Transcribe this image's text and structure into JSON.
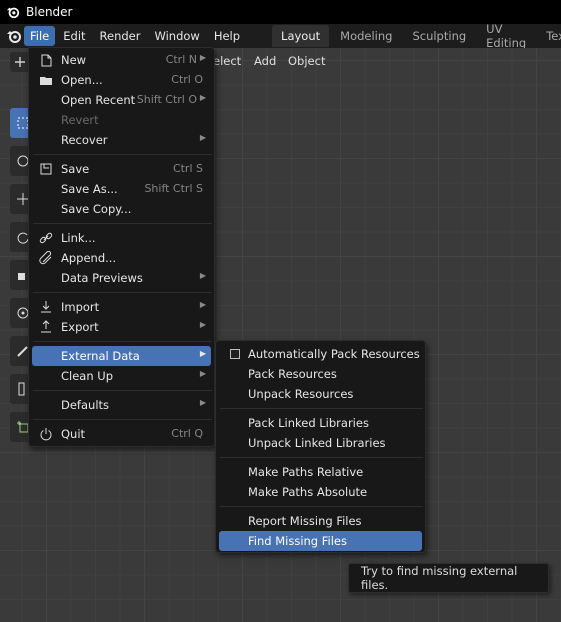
{
  "app": {
    "title": "Blender"
  },
  "topmenu": [
    "File",
    "Edit",
    "Render",
    "Window",
    "Help"
  ],
  "workspace_tabs": [
    "Layout",
    "Modeling",
    "Sculpting",
    "UV Editing",
    "Texture"
  ],
  "viewport_header": {
    "items": [
      "elect",
      "Add",
      "Object"
    ]
  },
  "file_menu": {
    "items": [
      {
        "label": "New",
        "shortcut": "Ctrl N",
        "submenu": true,
        "icon": "new-file-icon"
      },
      {
        "label": "Open...",
        "shortcut": "Ctrl O",
        "icon": "folder-icon"
      },
      {
        "label": "Open Recent",
        "shortcut": "Shift Ctrl O",
        "submenu": true
      },
      {
        "label": "Revert",
        "disabled": true
      },
      {
        "label": "Recover",
        "submenu": true
      },
      {
        "label": "Save",
        "shortcut": "Ctrl S",
        "icon": "save-icon"
      },
      {
        "label": "Save As...",
        "shortcut": "Shift Ctrl S"
      },
      {
        "label": "Save Copy..."
      },
      {
        "label": "Link...",
        "icon": "link-icon"
      },
      {
        "label": "Append...",
        "icon": "append-icon"
      },
      {
        "label": "Data Previews",
        "submenu": true
      },
      {
        "label": "Import",
        "submenu": true,
        "icon": "import-icon"
      },
      {
        "label": "Export",
        "submenu": true,
        "icon": "export-icon"
      },
      {
        "label": "External Data",
        "submenu": true,
        "highlighted": true
      },
      {
        "label": "Clean Up",
        "submenu": true
      },
      {
        "label": "Defaults",
        "submenu": true
      },
      {
        "label": "Quit",
        "shortcut": "Ctrl Q",
        "icon": "power-icon"
      }
    ]
  },
  "external_data_menu": {
    "items": [
      {
        "label": "Automatically Pack Resources",
        "checkbox": true,
        "checked": false
      },
      {
        "label": "Pack Resources"
      },
      {
        "label": "Unpack Resources"
      },
      {
        "label": "Pack Linked Libraries"
      },
      {
        "label": "Unpack Linked Libraries"
      },
      {
        "label": "Make Paths Relative"
      },
      {
        "label": "Make Paths Absolute"
      },
      {
        "label": "Report Missing Files"
      },
      {
        "label": "Find Missing Files",
        "highlighted": true
      }
    ]
  },
  "tooltip": {
    "text": "Try to find missing external files."
  },
  "colors": {
    "accent": "#4772b3",
    "menu_bg": "#181818",
    "titlebar": "#000000"
  }
}
